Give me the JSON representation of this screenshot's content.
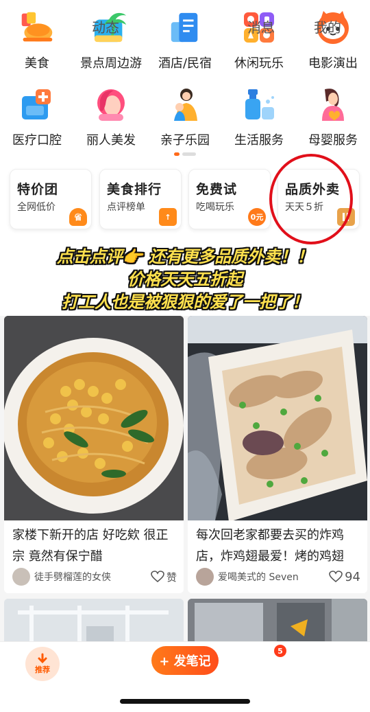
{
  "categories": [
    {
      "label": "美食",
      "icon": "roast-chicken-icon",
      "color": "#ff9a1f"
    },
    {
      "label": "景点周边游",
      "icon": "palm-tree-icon",
      "color": "#27a8f2"
    },
    {
      "label": "酒店/民宿",
      "icon": "hotel-icon",
      "color": "#2f8cf0"
    },
    {
      "label": "休闲玩乐",
      "icon": "leisure-grid-icon",
      "color": "#ff7a3d"
    },
    {
      "label": "电影演出",
      "icon": "cat-face-icon",
      "color": "#ff6a2b"
    },
    {
      "label": "医疗口腔",
      "icon": "medical-kit-icon",
      "color": "#2d9bf0"
    },
    {
      "label": "丽人美发",
      "icon": "beauty-woman-icon",
      "color": "#ff5c8a"
    },
    {
      "label": "亲子乐园",
      "icon": "parent-child-icon",
      "color": "#ffb02e"
    },
    {
      "label": "生活服务",
      "icon": "cleaning-spray-icon",
      "color": "#39a4f2"
    },
    {
      "label": "母婴服务",
      "icon": "mother-baby-icon",
      "color": "#ff6c98"
    }
  ],
  "promos": [
    {
      "title": "特价团",
      "sub": "全网低价",
      "badge": "省",
      "badge_color": "#ff8a1a"
    },
    {
      "title": "美食排行",
      "sub": "点评榜单",
      "badge": "↑",
      "badge_color": "#ff8a1a"
    },
    {
      "title": "免费试",
      "sub": "吃喝玩乐",
      "badge": "0元",
      "badge_color": "#ff7a1a"
    },
    {
      "title": "品质外卖",
      "sub": "天天５折",
      "badge": "",
      "badge_color": "#e8a24a"
    }
  ],
  "caption": [
    "点击点评👉 还有更多品质外卖！！",
    "价格天天五折起",
    "打工人也是被狠狠的爱了一把了！"
  ],
  "feed": [
    {
      "title": "家楼下新开的店 好吃欸 很正宗 竟然有保宁醋",
      "author": "徒手劈榴莲的女侠",
      "likes": "赞"
    },
    {
      "title": "每次回老家都要去买的炸鸡店，炸鸡翅最爱！烤的鸡翅",
      "author": "爱喝美式的 Seven",
      "likes": "94"
    }
  ],
  "tabs": {
    "recommend": "推荐",
    "dynamic": "动态",
    "post": "+ 发笔记",
    "messages": "消息",
    "messages_badge": "5",
    "mine": "我的"
  }
}
